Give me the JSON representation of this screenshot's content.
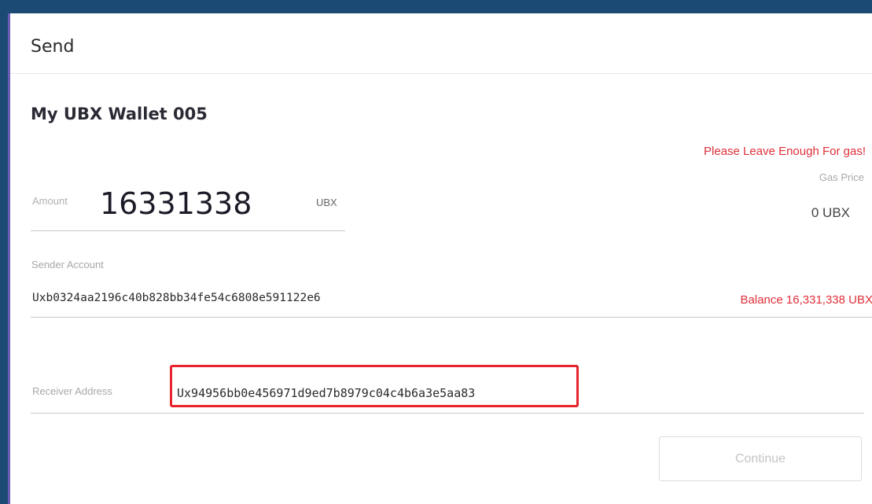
{
  "header": {
    "title": "Send"
  },
  "wallet": {
    "name": "My UBX Wallet 005"
  },
  "gas": {
    "warning": "Please Leave Enough For gas!",
    "price_label": "Gas Price",
    "price_value": "0 UBX"
  },
  "amount": {
    "label": "Amount",
    "value": "16331338",
    "unit": "UBX"
  },
  "sender": {
    "label": "Sender Account",
    "address": "Uxb0324aa2196c40b828bb34fe54c6808e591122e6",
    "balance": "Balance 16,331,338 UBX"
  },
  "receiver": {
    "label": "Receiver Address",
    "address": "Ux94956bb0e456971d9ed7b8979c04c4b6a3e5aa83"
  },
  "actions": {
    "continue_label": "Continue"
  },
  "colors": {
    "background": "#1b4a74",
    "warning": "#e0303a",
    "highlight_border": "#e8232d",
    "panel_accent": "#6b5bb5"
  }
}
